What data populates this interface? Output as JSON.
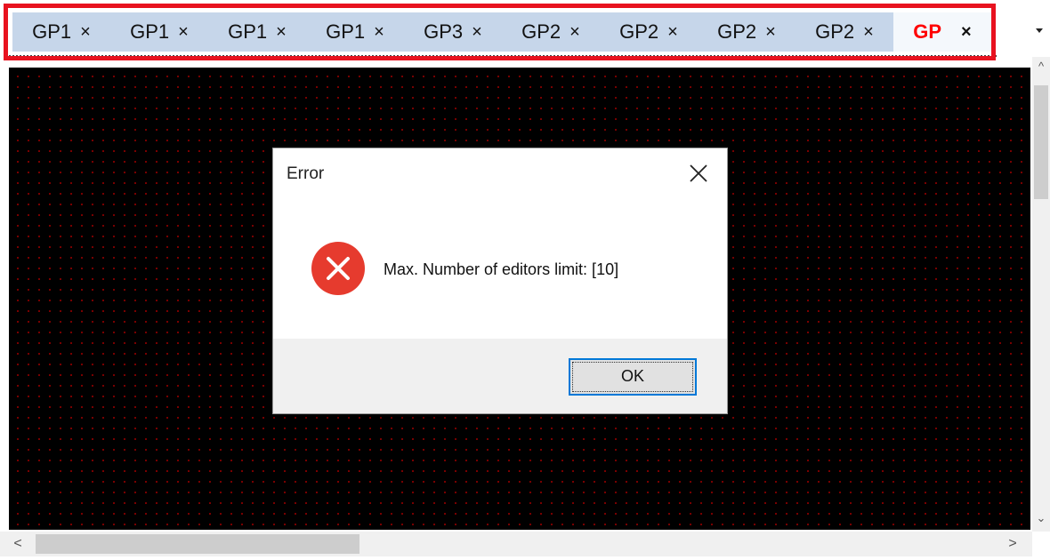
{
  "tabs": [
    {
      "label": "GP1",
      "close": "×",
      "active": false
    },
    {
      "label": "GP1",
      "close": "×",
      "active": false
    },
    {
      "label": "GP1",
      "close": "×",
      "active": false
    },
    {
      "label": "GP1",
      "close": "×",
      "active": false
    },
    {
      "label": "GP3",
      "close": "×",
      "active": false
    },
    {
      "label": "GP2",
      "close": "×",
      "active": false
    },
    {
      "label": "GP2",
      "close": "×",
      "active": false
    },
    {
      "label": "GP2",
      "close": "×",
      "active": false
    },
    {
      "label": "GP2",
      "close": "×",
      "active": false
    },
    {
      "label": "GP",
      "close": "×",
      "active": true
    }
  ],
  "tab_dropdown_icon": "triangle-down-icon",
  "colors": {
    "highlight": "#e8121f",
    "tabbar_bg": "#c6d6ea",
    "active_tab_text": "#ff0000",
    "canvas_bg": "#000000",
    "grid_dot": "#8a0000",
    "error_icon": "#e63b2e",
    "focus_border": "#0078d7"
  },
  "dialog": {
    "title": "Error",
    "close_icon": "close-icon",
    "icon": "error-icon",
    "message": "Max. Number of editors limit: [10]",
    "ok_label": "OK"
  },
  "scrollbars": {
    "up": "^",
    "down": "⌄",
    "left": "<",
    "right": ">"
  }
}
